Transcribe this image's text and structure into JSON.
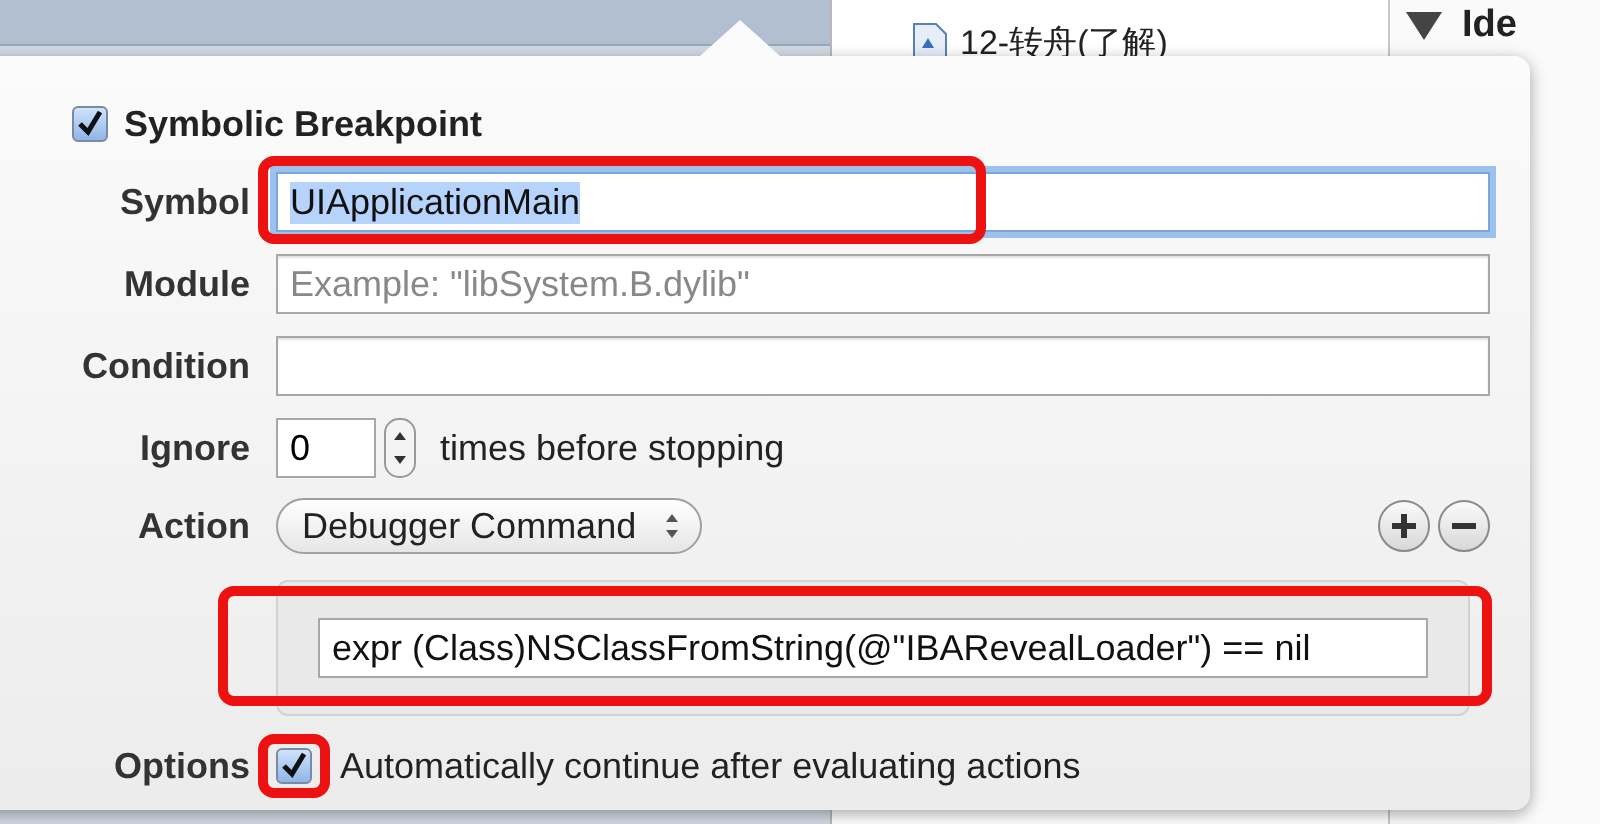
{
  "background": {
    "navigator_item": "12-转舟(了解)",
    "inspector_heading": "Ide"
  },
  "breakpoint": {
    "enabled": true,
    "title": "Symbolic Breakpoint",
    "fields": [
      {
        "label": "Symbol",
        "value": "UIApplicationMain",
        "focused": true,
        "highlighted": true
      },
      {
        "label": "Module",
        "placeholder": "Example: \"libSystem.B.dylib\"",
        "focused": false,
        "highlighted": false
      },
      {
        "label": "Condition",
        "focused": false,
        "highlighted": false
      }
    ],
    "ignore": {
      "label": "Ignore",
      "value": "0",
      "suffix": "times before stopping"
    },
    "action": {
      "label": "Action",
      "type": "Debugger Command",
      "command": "expr (Class)NSClassFromString(@\"IBARevealLoader\") == nil",
      "highlighted": true
    },
    "options": {
      "label": "Options",
      "auto_continue": true,
      "text": "Automatically continue after evaluating actions",
      "highlighted": true
    }
  }
}
